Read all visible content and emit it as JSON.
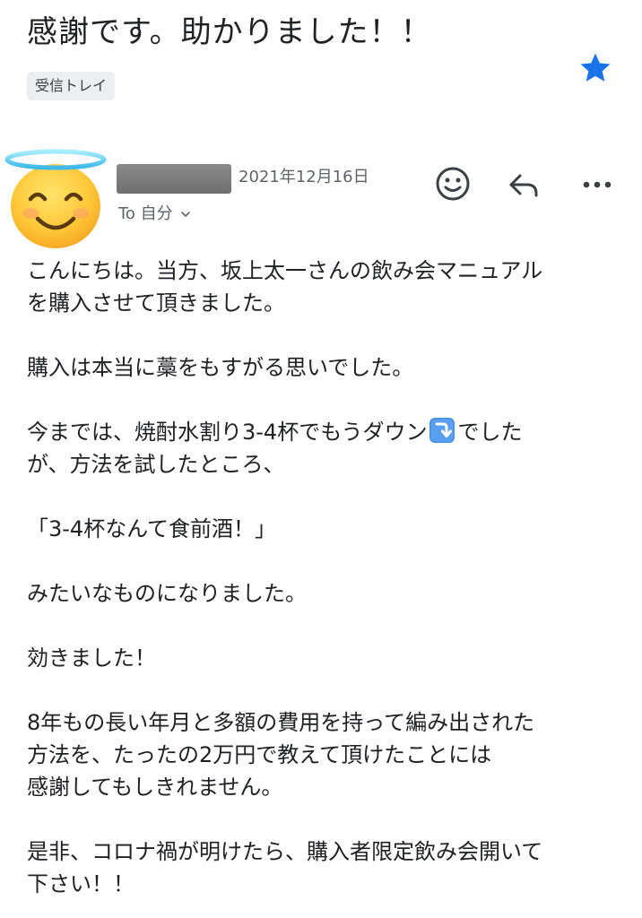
{
  "header": {
    "subject": "感謝です。助かりました！！",
    "label": "受信トレイ",
    "star_icon": "star-icon",
    "star_color": "#1a73e8"
  },
  "sender": {
    "avatar": "smiling-face-with-halo-emoji",
    "name_redacted": true,
    "date": "2021年12月16日",
    "recipient": "To 自分",
    "recipient_chevron": "chevron-down-icon"
  },
  "actions": {
    "emoji_icon": "emoji-reaction-icon",
    "reply_icon": "reply-icon",
    "more_icon": "more-options-icon"
  },
  "message": {
    "p1_line1": "こんにちは。当方、坂上太一さんの飲み会マニュアル",
    "p1_line2": "を購入させて頂きました。",
    "p2": "購入は本当に藁をもすがる思いでした。",
    "p3_line1_before": "今までは、焼酎水割り3-4杯でもうダウン",
    "p3_line1_emoji": "down-arrow-emoji",
    "p3_line1_after": "でした",
    "p3_line2": "が、方法を試したところ、",
    "p4": "「3-4杯なんて食前酒！」",
    "p5": "みたいなものになりました。",
    "p6": "効きました！",
    "p7_line1": "8年もの長い年月と多額の費用を持って編み出された",
    "p7_line2": "方法を、たったの2万円で教えて頂けたことには",
    "p7_line3": "感謝してもしきれません。",
    "p8_line1": "是非、コロナ禍が明けたら、購入者限定飲み会開いて",
    "p8_line2": "下さい！！"
  }
}
